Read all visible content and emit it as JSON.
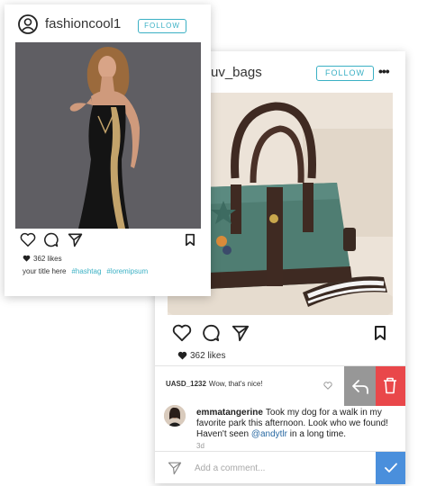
{
  "post1": {
    "username": "fashioncool1",
    "follow_label": "FOLLOW",
    "likes_text": "362 likes",
    "caption": "your title here",
    "hashtags": [
      "#hashtag",
      "#loremipsum"
    ]
  },
  "post2": {
    "username": "uv_bags",
    "follow_label": "FOLLOW",
    "likes_text": "362 likes",
    "comments": [
      {
        "user": "UASD_1232",
        "text": "Wow, that's nice!"
      },
      {
        "user": "emmatangerine",
        "text_before": "Took my dog for a walk in my favorite park this afternoon. Look who we found! Haven't seen ",
        "mention": "@andytlr",
        "text_after": " in a long time.",
        "time": "3d"
      }
    ],
    "add_comment_placeholder": "Add a comment..."
  },
  "colors": {
    "accent": "#3ab0c4",
    "delete": "#e9474a",
    "reply": "#979797",
    "submit": "#4a8fdc"
  }
}
